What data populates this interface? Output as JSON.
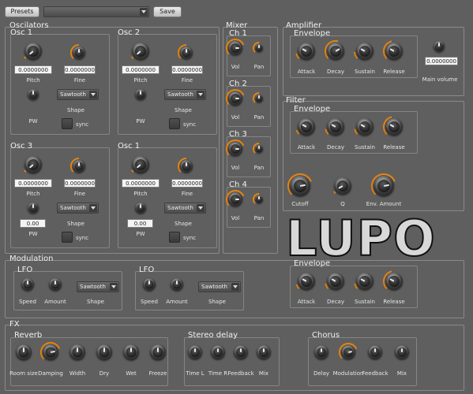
{
  "topbar": {
    "presets_label": "Presets",
    "preset_value": "",
    "save_label": "Save"
  },
  "oscillators": {
    "title": "Oscilators",
    "groups": [
      {
        "title": "Osc 1",
        "pitch": "0.0000000",
        "fine": "0.0000000",
        "pitch_label": "Pitch",
        "fine_label": "Fine",
        "pw_label": "PW",
        "shape_value": "Sawtooth",
        "shape_label": "Shape",
        "sync_label": "sync",
        "pw_value": ""
      },
      {
        "title": "Osc 2",
        "pitch": "0.0000000",
        "fine": "0.0000000",
        "pitch_label": "Pitch",
        "fine_label": "Fine",
        "pw_label": "PW",
        "shape_value": "Sawtooth",
        "shape_label": "Shape",
        "sync_label": "sync",
        "pw_value": ""
      },
      {
        "title": "Osc 3",
        "pitch": "0.0000000",
        "fine": "0.0000000",
        "pitch_label": "Pitch",
        "fine_label": "Fine",
        "pw_label": "PW",
        "shape_value": "Sawtooth",
        "shape_label": "Shape",
        "sync_label": "sync",
        "pw_value": "0.00"
      },
      {
        "title": "Osc 1",
        "pitch": "0.0000000",
        "fine": "0.0000000",
        "pitch_label": "Pitch",
        "fine_label": "Fine",
        "pw_label": "PW",
        "shape_value": "Sawtooth",
        "shape_label": "Shape",
        "sync_label": "sync",
        "pw_value": "0.00"
      }
    ]
  },
  "mixer": {
    "title": "Mixer",
    "channels": [
      {
        "title": "Ch 1",
        "vol_label": "Vol",
        "pan_label": "Pan"
      },
      {
        "title": "Ch 2",
        "vol_label": "Vol",
        "pan_label": "Pan"
      },
      {
        "title": "Ch 3",
        "vol_label": "Vol",
        "pan_label": "Pan"
      },
      {
        "title": "Ch 4",
        "vol_label": "Vol",
        "pan_label": "Pan"
      }
    ]
  },
  "amplifier": {
    "title": "Amplifier",
    "envelope_title": "Envelope",
    "attack": "Attack",
    "decay": "Decay",
    "sustain": "Sustain",
    "release": "Release",
    "main_volume_label": "Main volume",
    "main_volume_value": "0.0000000"
  },
  "filter": {
    "title": "Filter",
    "envelope_title": "Envelope",
    "attack": "Attack",
    "decay": "Decay",
    "sustain": "Sustain",
    "release": "Release",
    "cutoff": "Cutoff",
    "q": "Q",
    "env_amount": "Env. Amount"
  },
  "logo_text": "LUPO",
  "modulation": {
    "title": "Modulation",
    "lfos": [
      {
        "title": "LFO",
        "speed": "Speed",
        "amount": "Amount",
        "shape_label": "Shape",
        "shape_value": "Sawtooth"
      },
      {
        "title": "LFO",
        "speed": "Speed",
        "amount": "Amount",
        "shape_label": "Shape",
        "shape_value": "Sawtooth"
      }
    ],
    "envelope": {
      "title": "Envelope",
      "attack": "Attack",
      "decay": "Decay",
      "sustain": "Sustain",
      "release": "Release"
    }
  },
  "fx": {
    "title": "FX",
    "reverb": {
      "title": "Reverb",
      "room_size": "Room size",
      "damping": "Damping",
      "width": "Width",
      "dry": "Dry",
      "wet": "Wet",
      "freeze": "Freeze"
    },
    "stereo_delay": {
      "title": "Stereo delay",
      "time_l": "Time L",
      "time_r": "Time R",
      "feedback": "Feedback",
      "mix": "Mix"
    },
    "chorus": {
      "title": "Chorus",
      "delay": "Delay",
      "modulation": "Modulation",
      "feedback": "Feedback",
      "mix": "Mix"
    }
  },
  "colors": {
    "accent": "#e8850c",
    "background": "#5f5f5f"
  }
}
